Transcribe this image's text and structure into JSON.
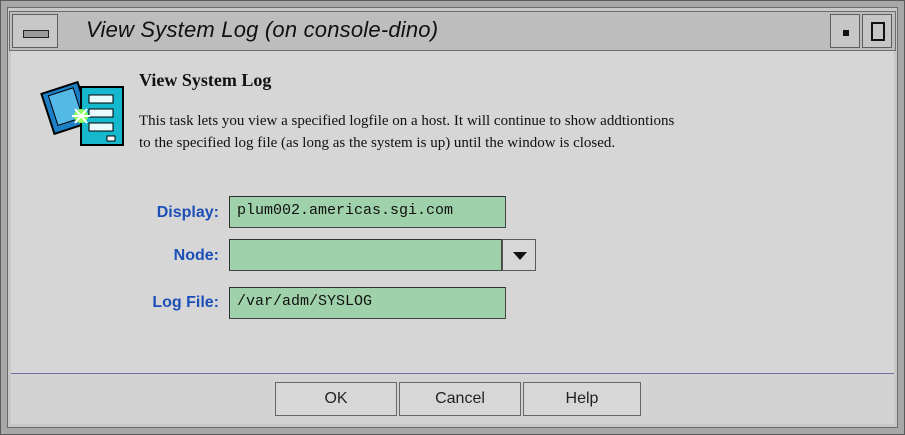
{
  "window": {
    "title": "View System Log (on console-dino)"
  },
  "task": {
    "title": "View System Log",
    "description_line1": "This task lets you view a specified logfile on a host.  It will continue to show addtiontions",
    "description_line2": "to the specified log file (as long as the system is up) until the window is closed.",
    "icon": "system-log-icon"
  },
  "form": {
    "display_label": "Display:",
    "display_value": "plum002.americas.sgi.com",
    "node_label": "Node:",
    "node_value": "",
    "log_file_label": "Log File:",
    "log_file_value": "/var/adm/SYSLOG"
  },
  "buttons": {
    "ok": "OK",
    "cancel": "Cancel",
    "help": "Help"
  },
  "colors": {
    "label_blue": "#1d4fb8",
    "field_green": "#9fd1aa",
    "panel_gray": "#d6d6d6"
  }
}
